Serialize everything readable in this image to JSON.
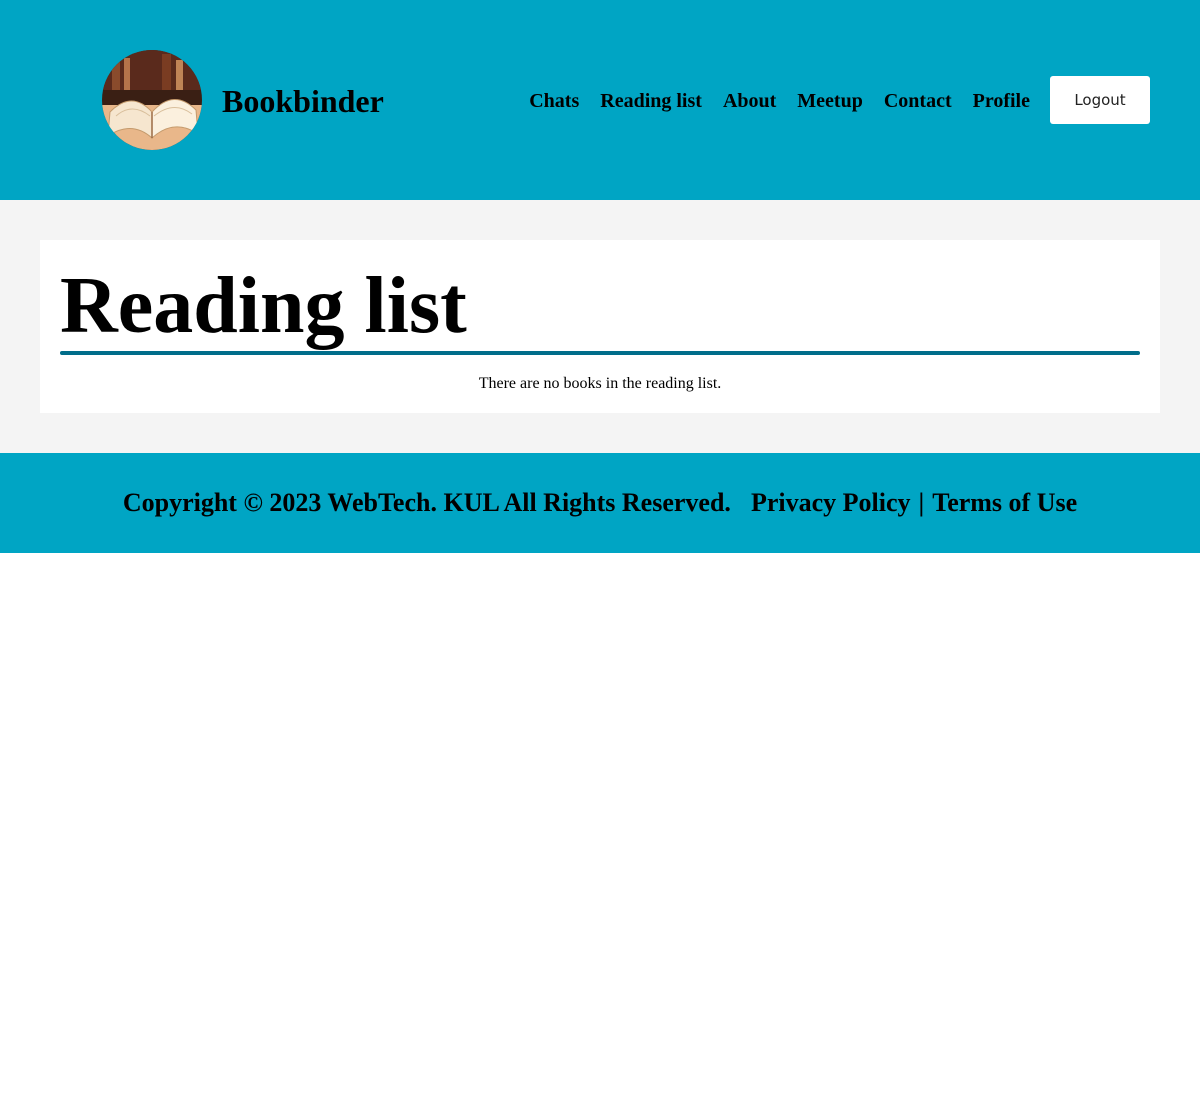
{
  "header": {
    "logo_icon": "open-book-logo",
    "brand": "Bookbinder",
    "nav": [
      "Chats",
      "Reading list",
      "About",
      "Meetup",
      "Contact",
      "Profile"
    ],
    "logout_label": "Logout"
  },
  "main": {
    "title": "Reading list",
    "empty_message": "There are no books in the reading list."
  },
  "footer": {
    "copyright": "Copyright © 2023 WebTech. KUL All Rights Reserved.",
    "privacy": "Privacy Policy",
    "separator": "|",
    "terms": "Terms of Use"
  },
  "colors": {
    "header_bg": "#00a5c4",
    "main_bg": "#f4f4f4",
    "title_rule": "#006d8a",
    "footer_bg": "#00a5c4"
  }
}
